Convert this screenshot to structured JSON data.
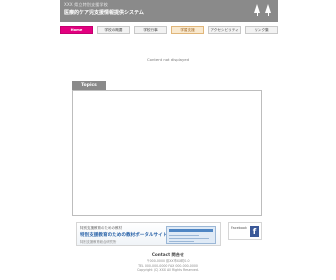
{
  "header": {
    "subtitle": "XXX 県立特別支援学校",
    "title": "医療的ケア児支援情報提供システム",
    "tree_icons": [
      "tree-icon",
      "tree-icon"
    ]
  },
  "nav": {
    "items": [
      {
        "label": "Home",
        "style": "home"
      },
      {
        "label": "学校の概要",
        "style": "normal"
      },
      {
        "label": "学校行事",
        "style": "normal"
      },
      {
        "label": "学習支援",
        "style": "orange"
      },
      {
        "label": "アクセシビリティ",
        "style": "normal"
      },
      {
        "label": "リンク集",
        "style": "normal"
      }
    ]
  },
  "main": {
    "center_text": "Content not displayed"
  },
  "topics": {
    "label": "Topics"
  },
  "banner": {
    "subtitle": "特別支援教育のための教材",
    "title": "特別支援教育のための教材ポータルサイト",
    "note": "特別支援教育総合研究所"
  },
  "facebook": {
    "text": "Facebook",
    "icon": "f"
  },
  "footer": {
    "title": "Contact 問合せ",
    "lines": [
      "〒000-0000 県XX市XX町0-0",
      "TEL 000-000-0000 FAX 000-000-0000",
      "Copyright (C) XXX All Rights Reserved."
    ]
  },
  "colors": {
    "header_bg": "#8a8a8a",
    "home_accent": "#e3007f",
    "banner_blue": "#2a63a8",
    "facebook_blue": "#3b5998"
  }
}
